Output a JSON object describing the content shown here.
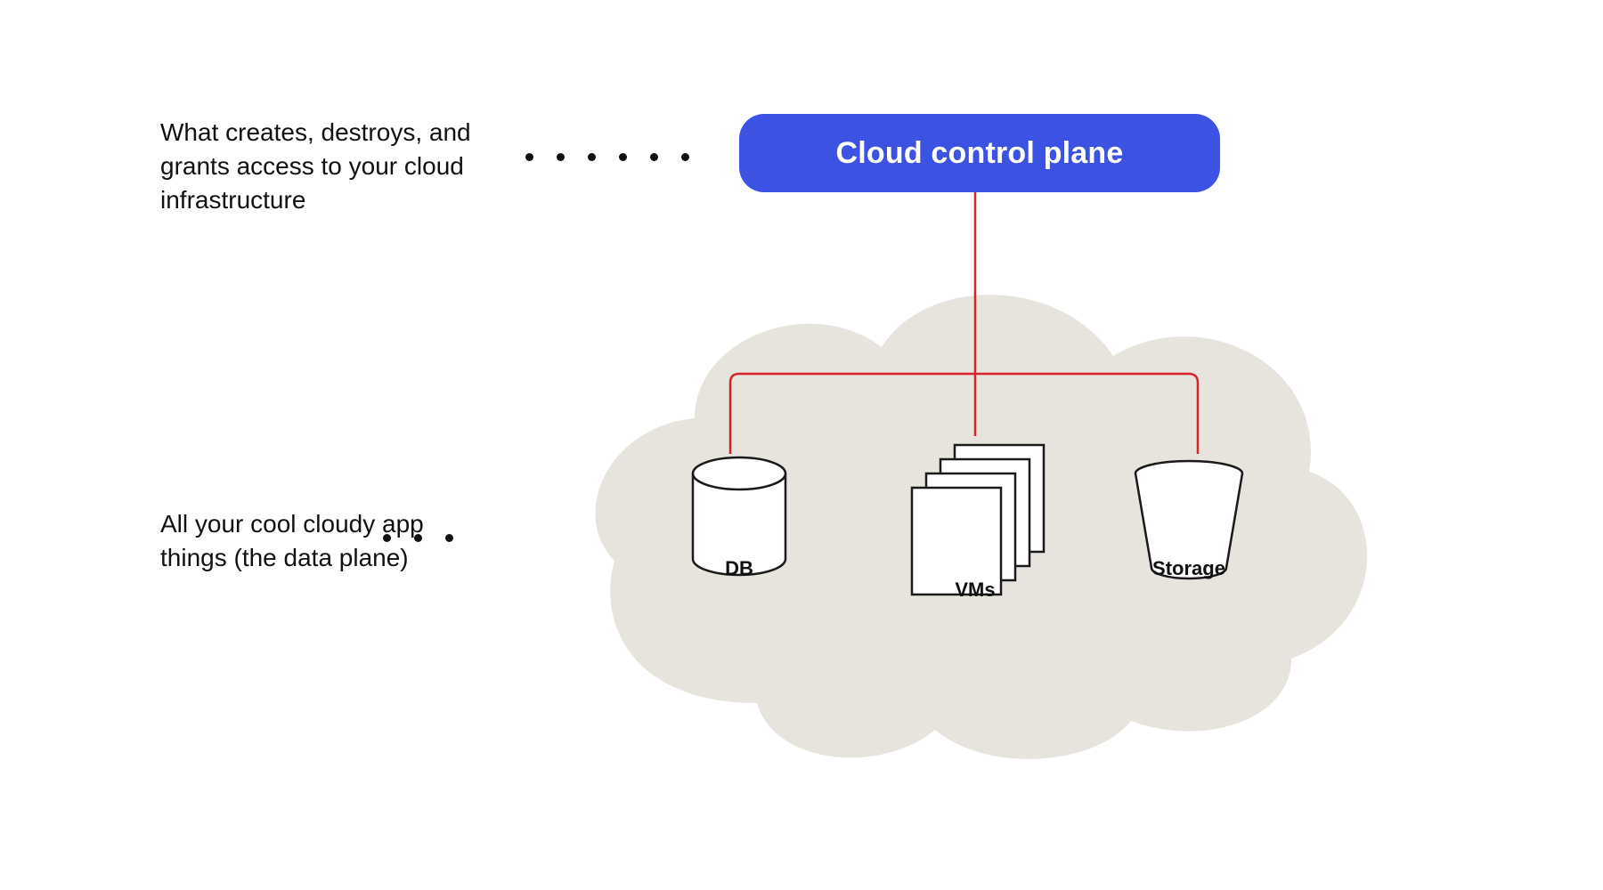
{
  "descriptions": {
    "control_plane": "What creates, destroys, and grants access to your cloud infrastructure",
    "data_plane": "All your cool cloudy app things (the data plane)"
  },
  "control_plane": {
    "title": "Cloud control plane"
  },
  "resources": {
    "db": "DB",
    "vms": "VMs",
    "storage": "Storage"
  },
  "colors": {
    "accent_blue": "#3b52e3",
    "connector_red": "#d9232a",
    "cloud_bg": "#e7e3dd",
    "icon_stroke": "#1a1a1a"
  }
}
